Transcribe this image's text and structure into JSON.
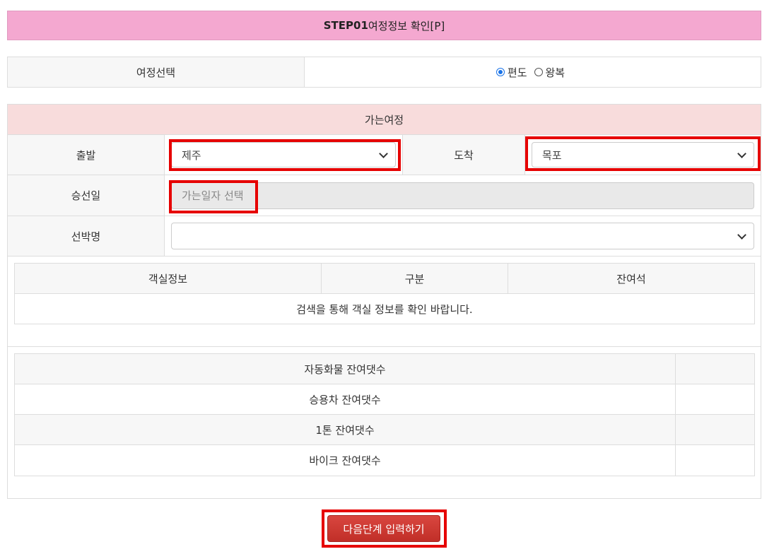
{
  "header": {
    "step": "STEP01",
    "title": "여정정보 확인[P]"
  },
  "trip_type": {
    "label": "여정선택",
    "options": [
      {
        "label": "편도",
        "checked": true
      },
      {
        "label": "왕복",
        "checked": false
      }
    ]
  },
  "outbound": {
    "title": "가는여정",
    "departure_label": "출발",
    "departure_value": "제주",
    "arrival_label": "도착",
    "arrival_value": "목포",
    "date_label": "승선일",
    "date_placeholder": "가는일자 선택",
    "ship_label": "선박명",
    "ship_value": ""
  },
  "cabin_table": {
    "headers": [
      "객실정보",
      "구분",
      "잔여석"
    ],
    "message": "검색을 통해 객실 정보를 확인 바랍니다."
  },
  "vehicle_table": {
    "rows": [
      {
        "label": "자동화물 잔여댓수",
        "value": ""
      },
      {
        "label": "승용차 잔여댓수",
        "value": ""
      },
      {
        "label": "1톤 잔여댓수",
        "value": ""
      },
      {
        "label": "바이크 잔여댓수",
        "value": ""
      }
    ]
  },
  "next_button": {
    "label": "다음단계 입력하기"
  },
  "colors": {
    "header_bg": "#f4a8d0",
    "section_title_bg": "#f8dcdc",
    "highlight": "#e60000",
    "button": "#c9352e"
  }
}
